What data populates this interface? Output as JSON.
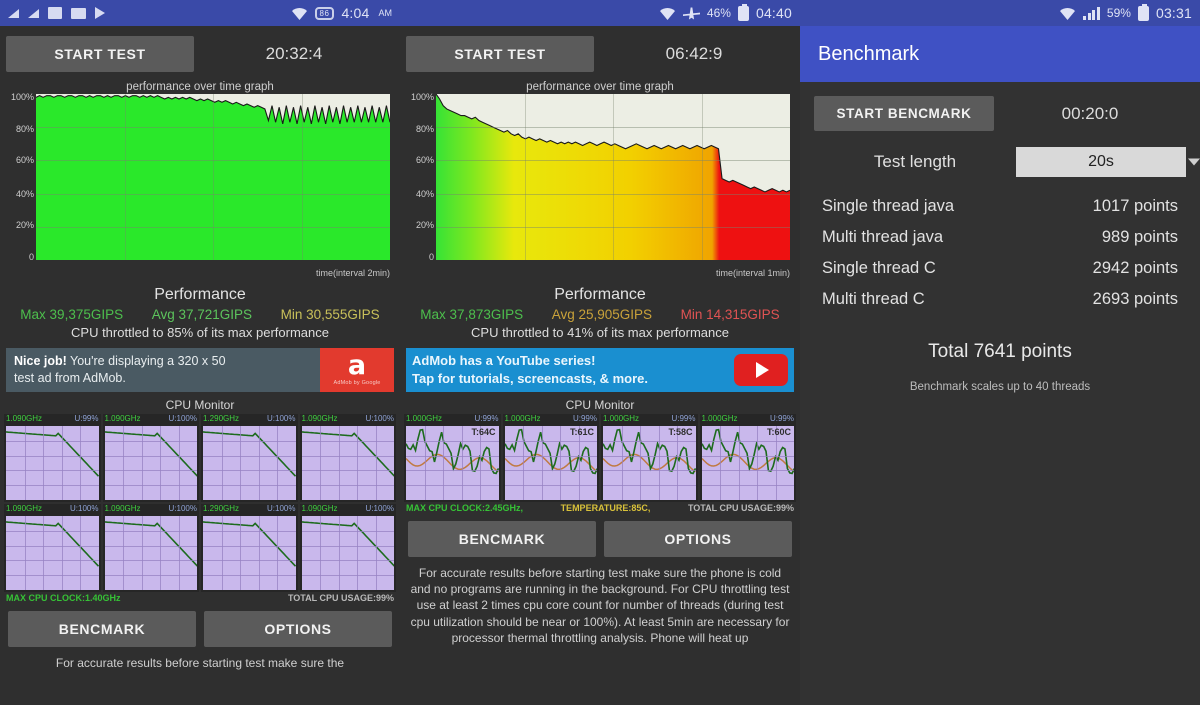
{
  "statusbars": [
    {
      "icons": [
        "signal-triangle-icon",
        "signal-triangle-icon",
        "image-icon",
        "mail-icon",
        "flag-icon"
      ],
      "wifi": "wifi-icon",
      "battery_pill": "86",
      "time": "4:04",
      "ampm": "AM"
    },
    {
      "wifi": "wifi-icon",
      "airplane": "airplane-icon",
      "percent": "46%",
      "time": "04:40"
    },
    {
      "wifi": "wifi-icon",
      "signal": "signal-bars-icon",
      "percent": "59%",
      "time": "03:31"
    }
  ],
  "panel1": {
    "start_button": "START TEST",
    "timer": "20:32:4",
    "graph_title": "performance over time graph",
    "y_ticks": [
      "100%",
      "80%",
      "60%",
      "40%",
      "20%",
      "0"
    ],
    "x_label": "time(interval 2min)",
    "perf_heading": "Performance",
    "max": "Max 39,375GIPS",
    "avg": "Avg 37,721GIPS",
    "min": "Min 30,555GIPS",
    "throttle": "CPU throttled to 85% of its max performance",
    "ad": {
      "line1_bold": "Nice job!",
      "line1": " You're displaying a 320 x 50",
      "line2": "test ad from AdMob.",
      "logo_letter": "a",
      "logo_sub": "AdMob by Google"
    },
    "cpu_monitor_title": "CPU Monitor",
    "cores": [
      {
        "freq": "1.090GHz",
        "usage": "U:99%"
      },
      {
        "freq": "1.090GHz",
        "usage": "U:100%"
      },
      {
        "freq": "1.290GHz",
        "usage": "U:100%"
      },
      {
        "freq": "1.090GHz",
        "usage": "U:100%"
      },
      {
        "freq": "1.090GHz",
        "usage": "U:100%"
      },
      {
        "freq": "1.090GHz",
        "usage": "U:100%"
      },
      {
        "freq": "1.290GHz",
        "usage": "U:100%"
      },
      {
        "freq": "1.090GHz",
        "usage": "U:100%"
      }
    ],
    "footer_left": "MAX CPU CLOCK:1.40GHz",
    "footer_right": "TOTAL CPU USAGE:99%",
    "bench_button": "BENCMARK",
    "options_button": "OPTIONS",
    "footnote": "For accurate results before starting test make sure the"
  },
  "panel2": {
    "start_button": "START TEST",
    "timer": "06:42:9",
    "graph_title": "performance over time graph",
    "y_ticks": [
      "100%",
      "80%",
      "60%",
      "40%",
      "20%",
      "0"
    ],
    "x_label": "time(interval 1min)",
    "perf_heading": "Performance",
    "max": "Max 37,873GIPS",
    "avg": "Avg 25,905GIPS",
    "min": "Min 14,315GIPS",
    "throttle": "CPU throttled to 41% of its max performance",
    "ad": {
      "line1": "AdMob has a YouTube series!",
      "line2": "Tap for tutorials, screencasts, & more.",
      "play": "play-icon"
    },
    "cpu_monitor_title": "CPU Monitor",
    "cores": [
      {
        "freq": "1.000GHz",
        "usage": "U:99%",
        "temp": "T:64C"
      },
      {
        "freq": "1.000GHz",
        "usage": "U:99%",
        "temp": "T:61C"
      },
      {
        "freq": "1.000GHz",
        "usage": "U:99%",
        "temp": "T:58C"
      },
      {
        "freq": "1.000GHz",
        "usage": "U:99%",
        "temp": "T:60C"
      }
    ],
    "footer_clock": "MAX CPU CLOCK:2.45GHz,",
    "footer_temp": "TEMPERATURE:85C,",
    "footer_usage": "TOTAL CPU USAGE:99%",
    "bench_button": "BENCMARK",
    "options_button": "OPTIONS",
    "footnote": "For accurate results before starting test make sure the phone is cold and no programs are running in the background. For CPU throttling test use at least 2 times cpu core count for number of threads (during test cpu utilization should be near or 100%). At least 5min are necessary for processor thermal throttling analysis. Phone will heat up"
  },
  "panel3": {
    "title": "Benchmark",
    "start_button": "START BENCMARK",
    "timer": "00:20:0",
    "test_length_label": "Test length",
    "test_length_value": "20s",
    "scores": [
      {
        "label": "Single thread java",
        "value": "1017 points"
      },
      {
        "label": "Multi thread java",
        "value": "989 points"
      },
      {
        "label": "Single thread C",
        "value": "2942 points"
      },
      {
        "label": "Multi thread C",
        "value": "2693 points"
      }
    ],
    "total": "Total 7641 points",
    "note": "Benchmark scales up to 40 threads"
  },
  "chart_data": [
    {
      "type": "area",
      "title": "performance over time graph",
      "xlabel": "time(interval 2min)",
      "ylabel": "",
      "ylim": [
        0,
        100
      ],
      "y_ticks": [
        0,
        20,
        40,
        60,
        80,
        100
      ],
      "grid": true,
      "series": [
        {
          "name": "performance %",
          "values": [
            98,
            99,
            98,
            99,
            99,
            98,
            99,
            99,
            98,
            99,
            99,
            98,
            99,
            99,
            98,
            99,
            98,
            99,
            99,
            98,
            99,
            98,
            99,
            99,
            98,
            99,
            98,
            99,
            99,
            98,
            99,
            98,
            99,
            98,
            99,
            98,
            97,
            98,
            97,
            98,
            97,
            98,
            97,
            98,
            97,
            96,
            97,
            96,
            97,
            96,
            95,
            96,
            95,
            96,
            95,
            94,
            95,
            94,
            93,
            94,
            93,
            92,
            93,
            92,
            91,
            84,
            93,
            83,
            92,
            82,
            93,
            83,
            92,
            82,
            93,
            83,
            92,
            82,
            93,
            83,
            92,
            82,
            93,
            83,
            92,
            82,
            93,
            83,
            92,
            83,
            93,
            83,
            92,
            83,
            93,
            83,
            92,
            83,
            93,
            83
          ]
        }
      ],
      "stats": {
        "max": 39375,
        "avg": 37721,
        "min": 30555,
        "unit": "GIPS",
        "throttle_pct": 85
      }
    },
    {
      "type": "area",
      "title": "performance over time graph",
      "xlabel": "time(interval 1min)",
      "ylabel": "",
      "ylim": [
        0,
        100
      ],
      "y_ticks": [
        0,
        20,
        40,
        60,
        80,
        100
      ],
      "grid": true,
      "series": [
        {
          "name": "performance %",
          "values": [
            100,
            97,
            93,
            91,
            90,
            89,
            88,
            87,
            87,
            86,
            85,
            86,
            84,
            83,
            82,
            81,
            80,
            79,
            78,
            77,
            78,
            76,
            75,
            76,
            74,
            73,
            74,
            73,
            72,
            73,
            72,
            71,
            72,
            71,
            70,
            71,
            70,
            71,
            70,
            71,
            70,
            69,
            70,
            71,
            70,
            69,
            70,
            71,
            70,
            69,
            70,
            69,
            68,
            67,
            68,
            69,
            70,
            69,
            68,
            67,
            68,
            69,
            68,
            67,
            68,
            69,
            68,
            67,
            68,
            69,
            68,
            67,
            68,
            69,
            68,
            67,
            68,
            69,
            68,
            67,
            49,
            48,
            47,
            48,
            47,
            46,
            45,
            44,
            43,
            44,
            43,
            42,
            41,
            42,
            43,
            42,
            41,
            42,
            41,
            42
          ]
        }
      ],
      "stats": {
        "max": 37873,
        "avg": 25905,
        "min": 14315,
        "unit": "GIPS",
        "throttle_pct": 41
      }
    }
  ]
}
